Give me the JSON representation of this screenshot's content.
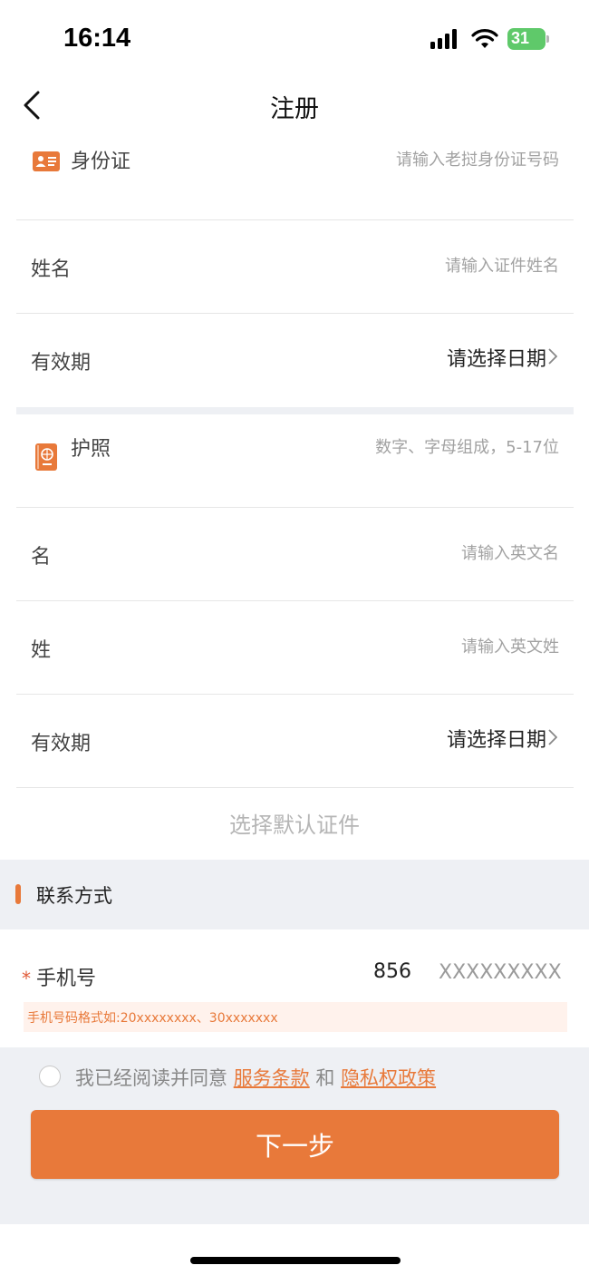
{
  "status_bar": {
    "time": "16:14",
    "battery": "31"
  },
  "nav": {
    "title": "注册"
  },
  "id_card": {
    "header_label": "身份证",
    "header_placeholder": "请输入老挝身份证号码",
    "name_label": "姓名",
    "name_placeholder": "请输入证件姓名",
    "expiry_label": "有效期",
    "expiry_value": "请选择日期"
  },
  "passport": {
    "header_label": "护照",
    "header_placeholder": "数字、字母组成，5-17位",
    "given_name_label": "名",
    "given_name_placeholder": "请输入英文名",
    "surname_label": "姓",
    "surname_placeholder": "请输入英文姓",
    "expiry_label": "有效期",
    "expiry_value": "请选择日期"
  },
  "default_document": "选择默认证件",
  "contact": {
    "title": "联系方式",
    "required_mark": "*",
    "phone_label": "手机号",
    "country_code": "856",
    "phone_placeholder": "XXXXXXXXX",
    "phone_tip": "手机号码格式如:20xxxxxxxx、30xxxxxxx"
  },
  "agreement": {
    "prefix": "我已经阅读并同意",
    "terms": "服务条款",
    "and": "和",
    "privacy": "隐私权政策"
  },
  "next_button": "下一步",
  "colors": {
    "accent": "#e8793a",
    "section_bg": "#eef0f4"
  }
}
